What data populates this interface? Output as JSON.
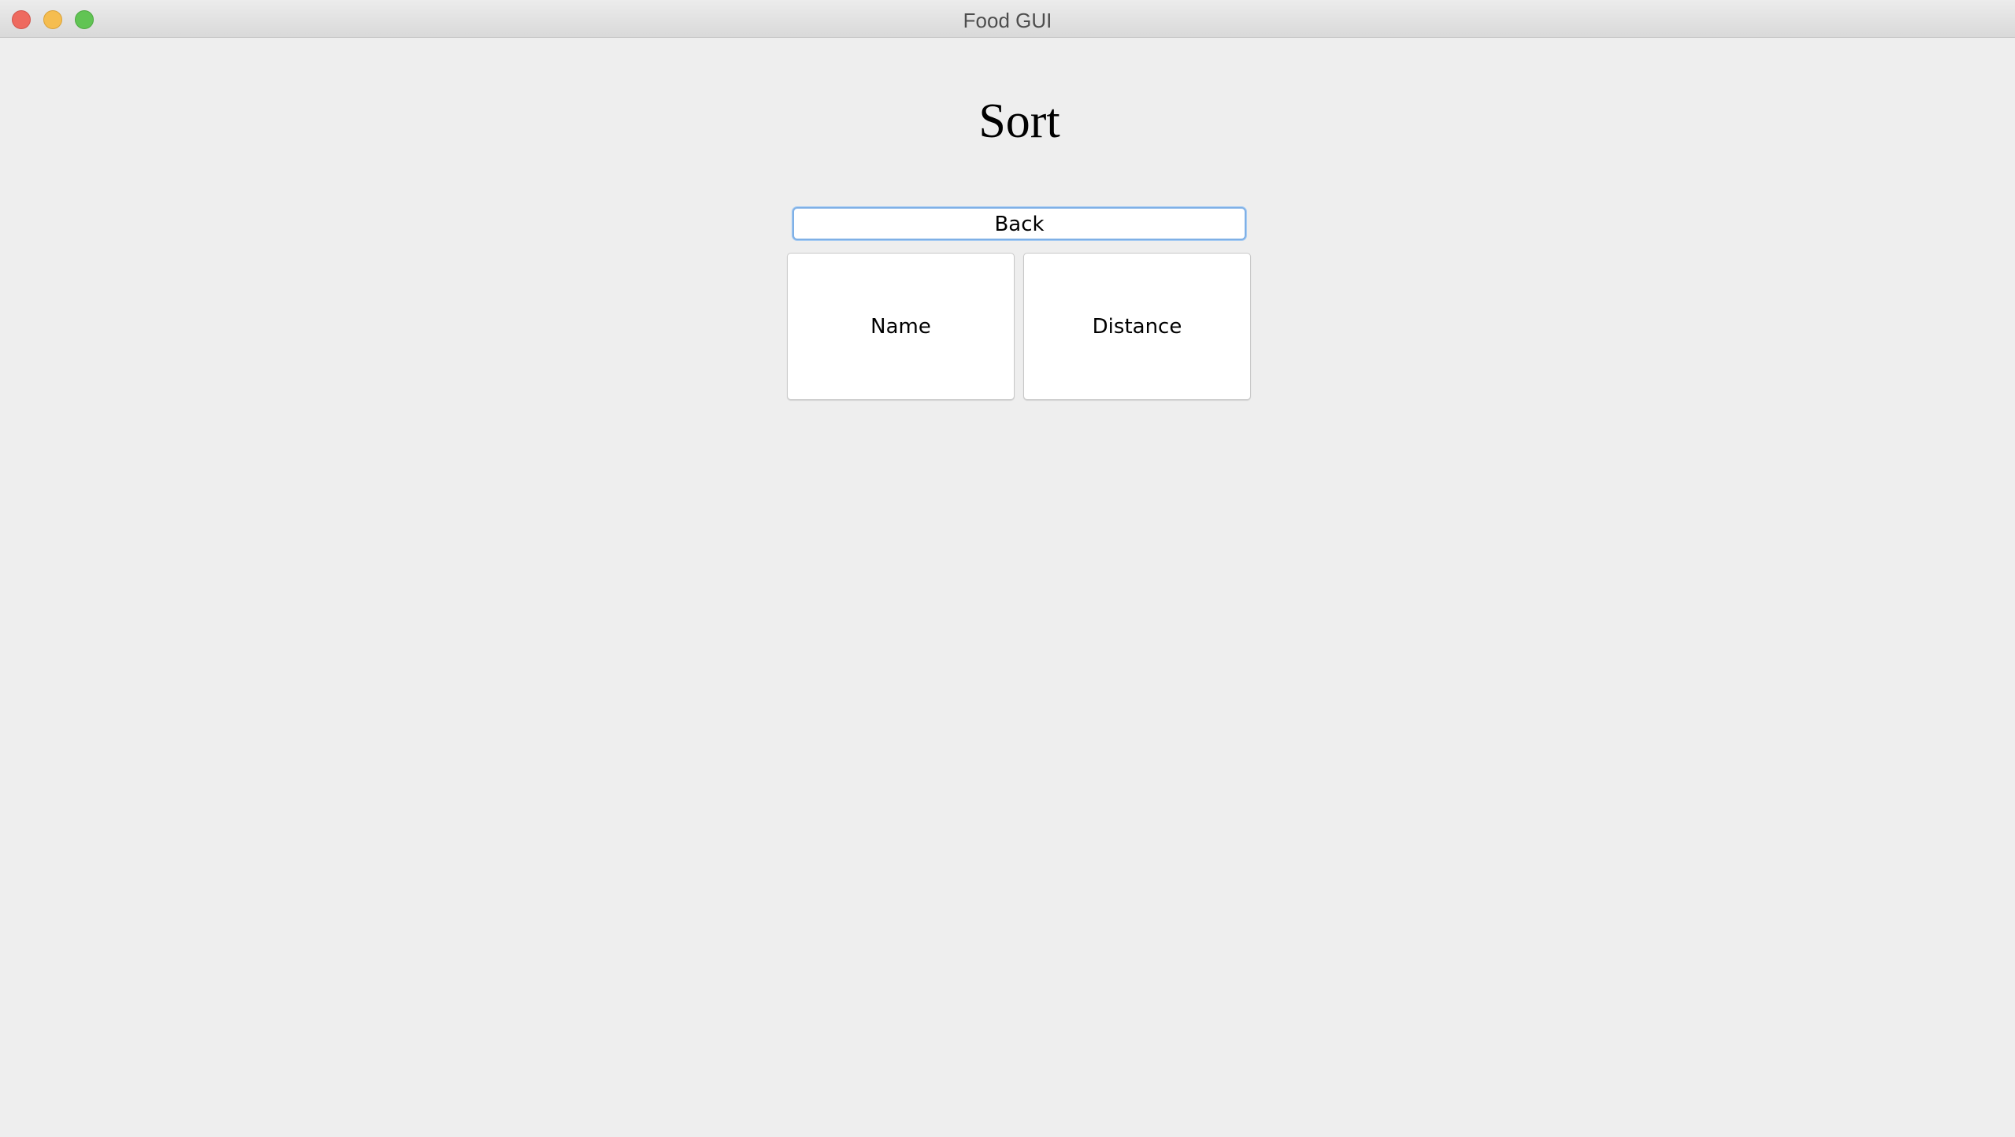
{
  "window": {
    "title": "Food GUI"
  },
  "page": {
    "title": "Sort"
  },
  "buttons": {
    "back_label": "Back",
    "name_label": "Name",
    "distance_label": "Distance"
  },
  "colors": {
    "background": "#eeeeee",
    "button_background": "#ffffff",
    "focus_ring": "#7fb0e6",
    "close": "#ee6a5f",
    "minimize": "#f5bd4f",
    "zoom": "#61c454"
  },
  "icons": {
    "close": "close-icon",
    "minimize": "minimize-icon",
    "zoom": "zoom-icon"
  }
}
